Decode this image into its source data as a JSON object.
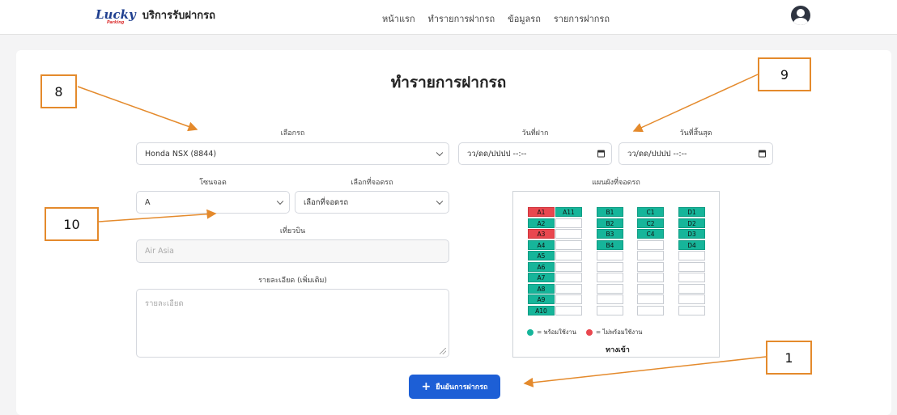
{
  "nav": {
    "logo_text": "Lucky",
    "logo_sub": "Parking",
    "brand": "บริการรับฝากรถ",
    "links": [
      "หน้าแรก",
      "ทำรายการฝากรถ",
      "ข้อมูลรถ",
      "รายการฝากรถ"
    ]
  },
  "form": {
    "title": "ทำรายการฝากรถ",
    "car_label": "เลือกรถ",
    "car_value": "Honda NSX (8844)",
    "start_label": "วันที่ฝาก",
    "start_placeholder": "วว/ดด/ปปปป --:--",
    "end_label": "วันที่สิ้นสุด",
    "end_placeholder": "วว/ดด/ปปปป --:--",
    "zone_label": "โซนจอด",
    "zone_value": "A",
    "spot_label": "เลือกที่จอดรถ",
    "spot_value": "เลือกที่จอดรถ",
    "flight_label": "เที่ยวบิน",
    "flight_value": "Air Asia",
    "detail_label": "รายละเอียด (เพิ่มเติม)",
    "detail_placeholder": "รายละเอียด",
    "submit_label": "ยืนยันการฝากรถ",
    "submit_icon": "plus-icon"
  },
  "map": {
    "title": "แผนผังที่จอดรถ",
    "columns": [
      {
        "zone": "A",
        "slots": [
          {
            "label": "A1",
            "status": "unavailable"
          },
          {
            "label": "A2",
            "status": "available"
          },
          {
            "label": "A3",
            "status": "unavailable"
          },
          {
            "label": "A4",
            "status": "available"
          },
          {
            "label": "A5",
            "status": "available"
          },
          {
            "label": "A6",
            "status": "available"
          },
          {
            "label": "A7",
            "status": "available"
          },
          {
            "label": "A8",
            "status": "available"
          },
          {
            "label": "A9",
            "status": "available"
          },
          {
            "label": "A10",
            "status": "available"
          }
        ]
      },
      {
        "zone": "A-extra",
        "slots": [
          {
            "label": "A11",
            "status": "available"
          },
          {
            "label": "",
            "status": "empty"
          },
          {
            "label": "",
            "status": "empty"
          },
          {
            "label": "",
            "status": "empty"
          },
          {
            "label": "",
            "status": "empty"
          },
          {
            "label": "",
            "status": "empty"
          },
          {
            "label": "",
            "status": "empty"
          },
          {
            "label": "",
            "status": "empty"
          },
          {
            "label": "",
            "status": "empty"
          },
          {
            "label": "",
            "status": "empty"
          }
        ]
      },
      {
        "zone": "B",
        "slots": [
          {
            "label": "B1",
            "status": "available"
          },
          {
            "label": "B2",
            "status": "available"
          },
          {
            "label": "B3",
            "status": "available"
          },
          {
            "label": "B4",
            "status": "available"
          },
          {
            "label": "",
            "status": "empty"
          },
          {
            "label": "",
            "status": "empty"
          },
          {
            "label": "",
            "status": "empty"
          },
          {
            "label": "",
            "status": "empty"
          },
          {
            "label": "",
            "status": "empty"
          },
          {
            "label": "",
            "status": "empty"
          }
        ]
      },
      {
        "zone": "C",
        "slots": [
          {
            "label": "C1",
            "status": "available"
          },
          {
            "label": "C2",
            "status": "available"
          },
          {
            "label": "C4",
            "status": "available"
          },
          {
            "label": "",
            "status": "empty"
          },
          {
            "label": "",
            "status": "empty"
          },
          {
            "label": "",
            "status": "empty"
          },
          {
            "label": "",
            "status": "empty"
          },
          {
            "label": "",
            "status": "empty"
          },
          {
            "label": "",
            "status": "empty"
          },
          {
            "label": "",
            "status": "empty"
          }
        ]
      },
      {
        "zone": "D",
        "slots": [
          {
            "label": "D1",
            "status": "available"
          },
          {
            "label": "D2",
            "status": "available"
          },
          {
            "label": "D3",
            "status": "available"
          },
          {
            "label": "D4",
            "status": "available"
          },
          {
            "label": "",
            "status": "empty"
          },
          {
            "label": "",
            "status": "empty"
          },
          {
            "label": "",
            "status": "empty"
          },
          {
            "label": "",
            "status": "empty"
          },
          {
            "label": "",
            "status": "empty"
          },
          {
            "label": "",
            "status": "empty"
          }
        ]
      }
    ],
    "legend_available": "= พร้อมใช้งาน",
    "legend_unavailable": "= ไม่พร้อมใช้งาน",
    "entrance": "ทางเข้า",
    "colors": {
      "available": "#16b59a",
      "unavailable": "#e9474f"
    }
  },
  "annotations": [
    "8",
    "9",
    "10",
    "1"
  ],
  "colors": {
    "accent": "#1d5fd6",
    "annotation": "#e48a2c"
  }
}
